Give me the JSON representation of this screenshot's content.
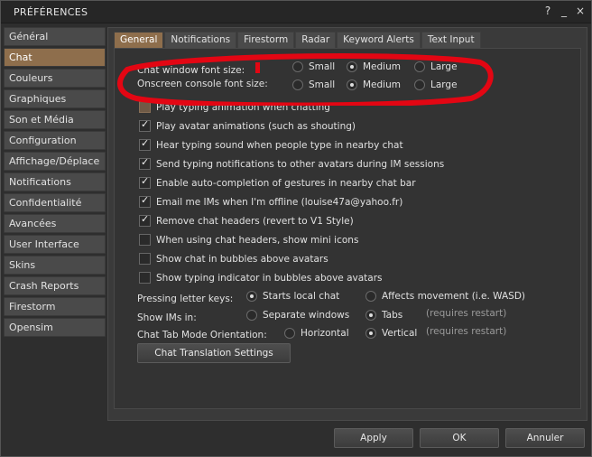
{
  "window": {
    "title": "PRÉFÉRENCES",
    "buttons": [
      "?",
      "_",
      "×"
    ]
  },
  "sidebar": {
    "items": [
      {
        "label": "Général"
      },
      {
        "label": "Chat"
      },
      {
        "label": "Couleurs"
      },
      {
        "label": "Graphiques"
      },
      {
        "label": "Son et Média"
      },
      {
        "label": "Configuration"
      },
      {
        "label": "Affichage/Déplace"
      },
      {
        "label": "Notifications"
      },
      {
        "label": "Confidentialité"
      },
      {
        "label": "Avancées"
      },
      {
        "label": "User Interface"
      },
      {
        "label": "Skins"
      },
      {
        "label": "Crash Reports"
      },
      {
        "label": "Firestorm"
      },
      {
        "label": "Opensim"
      }
    ],
    "active_index": 1
  },
  "tabs": [
    {
      "label": "General"
    },
    {
      "label": "Notifications"
    },
    {
      "label": "Firestorm"
    },
    {
      "label": "Radar"
    },
    {
      "label": "Keyword Alerts"
    },
    {
      "label": "Text Input"
    }
  ],
  "font_size": {
    "chat_label": "Chat window font size:",
    "console_label": "Onscreen console font size:",
    "options": [
      "Small",
      "Medium",
      "Large"
    ],
    "chat_selected": "Medium",
    "console_selected": "Medium"
  },
  "checkboxes": [
    {
      "label": "Play typing animation when chatting",
      "checked": false
    },
    {
      "label": "Play avatar animations (such as shouting)",
      "checked": true
    },
    {
      "label": "Hear typing sound when people type in nearby chat",
      "checked": true
    },
    {
      "label": "Send typing notifications to other avatars during IM sessions",
      "checked": true
    },
    {
      "label": "Enable auto-completion of gestures in nearby chat bar",
      "checked": true
    },
    {
      "label": "Email me IMs when I'm offline (louise47a@yahoo.fr)",
      "checked": true
    },
    {
      "label": "Remove chat headers (revert to V1 Style)",
      "checked": true
    },
    {
      "label": "When using chat headers, show mini icons",
      "checked": false
    },
    {
      "label": "Show chat in bubbles above avatars",
      "checked": false
    },
    {
      "label": "Show typing indicator in bubbles above avatars",
      "checked": false
    }
  ],
  "letter_keys": {
    "label": "Pressing letter keys:",
    "options": [
      "Starts local chat",
      "Affects movement (i.e. WASD)"
    ],
    "selected": "Starts local chat"
  },
  "show_ims": {
    "label": "Show IMs in:",
    "options": [
      "Separate windows",
      "Tabs"
    ],
    "selected": "Tabs",
    "note": "(requires restart)"
  },
  "tab_orientation": {
    "label": "Chat Tab Mode Orientation:",
    "options": [
      "Horizontal",
      "Vertical"
    ],
    "selected": "Vertical",
    "note": "(requires restart)"
  },
  "translation_button": "Chat Translation Settings",
  "footer": {
    "apply": "Apply",
    "ok": "OK",
    "cancel": "Annuler"
  },
  "colors": {
    "accent": "#8e6e4c",
    "annotation": "#e30613"
  }
}
